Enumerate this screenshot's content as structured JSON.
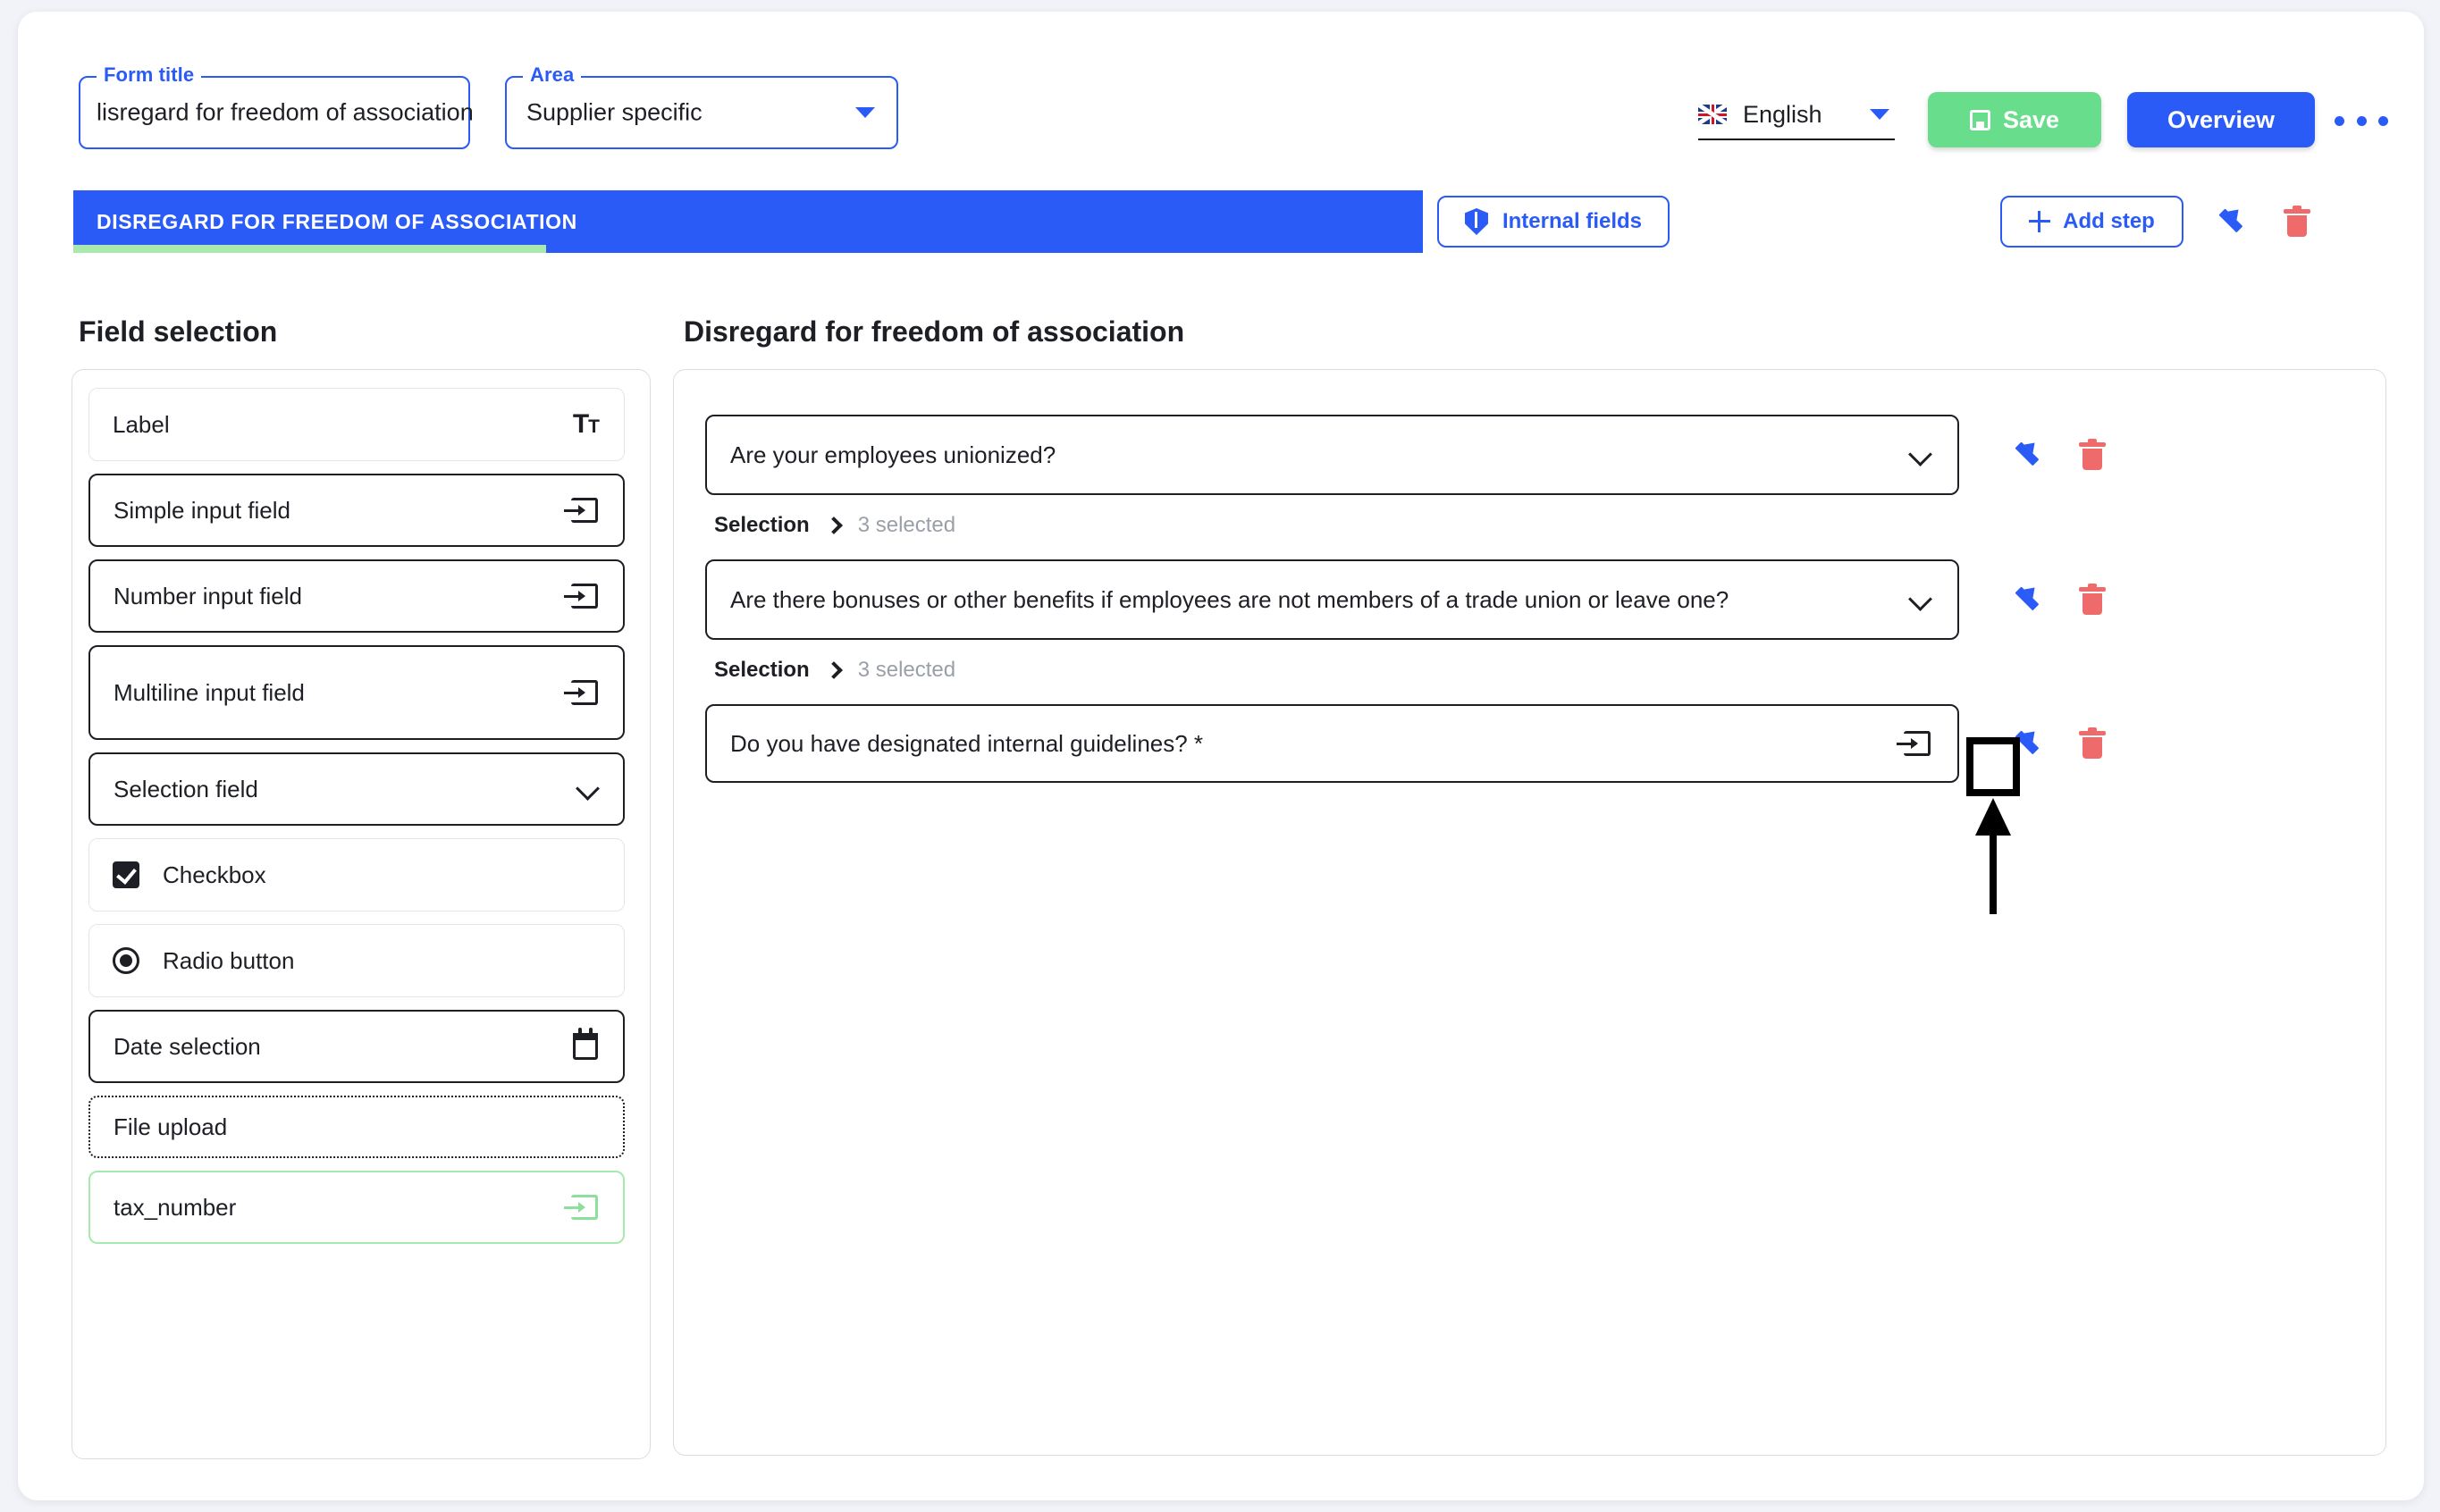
{
  "header": {
    "form_title_legend": "Form title",
    "form_title_value": "lisregard for freedom of association",
    "area_legend": "Area",
    "area_value": "Supplier specific",
    "language": "English",
    "language_icon": "uk-flag-icon",
    "save_label": "Save",
    "save_icon": "save-disk-icon",
    "overview_label": "Overview",
    "more_icon": "ellipsis-icon",
    "accent_blue": "#2a5bf6",
    "save_green": "#68dd8b",
    "delete_red": "#ef6b6b"
  },
  "stepbar": {
    "step_label": "DISREGARD FOR FREEDOM OF ASSOCIATION",
    "progress_percent": 35,
    "internal_fields_label": "Internal fields",
    "internal_fields_icon": "shield-icon",
    "add_step_label": "Add step",
    "add_step_icon": "plus-icon",
    "edit_icon": "pencil-icon",
    "delete_icon": "trash-icon"
  },
  "sidebar": {
    "title": "Field selection",
    "items": [
      {
        "label": "Label",
        "icon": "text-format-icon",
        "border": "light"
      },
      {
        "label": "Simple input field",
        "icon": "input-arrow-icon",
        "border": "dark"
      },
      {
        "label": "Number input field",
        "icon": "input-arrow-icon",
        "border": "dark"
      },
      {
        "label": "Multiline input field",
        "icon": "input-arrow-icon",
        "border": "dark"
      },
      {
        "label": "Selection field",
        "icon": "chevron-down-icon",
        "border": "dark"
      },
      {
        "label": "Checkbox",
        "icon": "checkbox-icon",
        "border": "light"
      },
      {
        "label": "Radio button",
        "icon": "radio-button-icon",
        "border": "light"
      },
      {
        "label": "Date selection",
        "icon": "calendar-icon",
        "border": "dark"
      },
      {
        "label": "File upload",
        "icon": "none",
        "border": "dashed"
      },
      {
        "label": "tax_number",
        "icon": "input-arrow-icon",
        "border": "green"
      }
    ]
  },
  "main": {
    "title": "Disregard for freedom of association",
    "questions": [
      {
        "text": "Are your employees unionized?",
        "icon": "chevron-down-icon",
        "meta_type": "Selection",
        "meta_count": "3 selected",
        "edit_icon": "pencil-icon",
        "delete_icon": "trash-icon"
      },
      {
        "text": "Are there bonuses or other benefits if employees are not members of a trade union or leave one?",
        "icon": "chevron-down-icon",
        "meta_type": "Selection",
        "meta_count": "3 selected",
        "edit_icon": "pencil-icon",
        "delete_icon": "trash-icon"
      },
      {
        "text": "Do you have designated internal guidelines? *",
        "icon": "input-arrow-icon",
        "meta_type": "",
        "meta_count": "",
        "edit_icon": "pencil-icon",
        "delete_icon": "trash-icon"
      }
    ]
  },
  "annotation": {
    "highlighted_target": "edit-question-3-button",
    "shape": "black-rectangle-with-up-arrow"
  }
}
